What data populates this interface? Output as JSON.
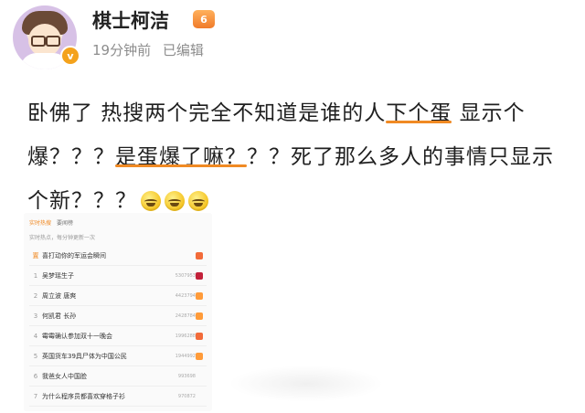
{
  "author": {
    "name": "棋士柯洁",
    "time": "19分钟前",
    "edited": "已编辑",
    "verified_mark": "v",
    "badge_text": "6"
  },
  "post": {
    "seg1": "卧佛了 热搜两个完全不知道是谁的人",
    "hl1": "下个蛋",
    "seg2": "显示个爆？？？",
    "hl2": "是蛋爆了嘛？",
    "seg3": "？？死了那么多人的事情只显示个新？？？"
  },
  "hot_search": {
    "tabs": [
      "实时热搜",
      "要闻榜"
    ],
    "note": "实时热点，每分钟更新一次",
    "rows": [
      {
        "rank": "置",
        "title": "喜打动你的军运会瞬间",
        "num": "",
        "tag": "hot"
      },
      {
        "rank": "1",
        "title": "吴梦瑶生子",
        "num": "5307953",
        "tag": "boil"
      },
      {
        "rank": "2",
        "title": "周立波 唐爽",
        "num": "4423794",
        "tag": "new"
      },
      {
        "rank": "3",
        "title": "何凯君 长孙",
        "num": "2428784",
        "tag": "new"
      },
      {
        "rank": "4",
        "title": "霉霉确认参加双十一晚会",
        "num": "1996288",
        "tag": "hot"
      },
      {
        "rank": "5",
        "title": "英国货车39具尸体为中国公民",
        "num": "1944992",
        "tag": "new"
      },
      {
        "rank": "6",
        "title": "我爸女人中国脸",
        "num": "993698",
        "tag": "none"
      },
      {
        "rank": "7",
        "title": "为什么程序员都喜欢穿格子衫",
        "num": "970872",
        "tag": "none"
      }
    ]
  }
}
